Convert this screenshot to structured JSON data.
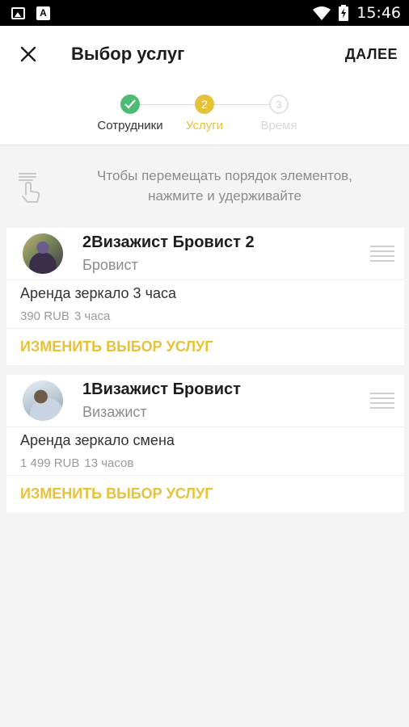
{
  "status_bar": {
    "time": "15:46",
    "icons": [
      "image-icon",
      "a-icon",
      "wifi-icon",
      "battery-charging-icon"
    ]
  },
  "app_bar": {
    "title": "Выбор услуг",
    "next_label": "ДАЛЕЕ",
    "close_icon": "close-icon"
  },
  "stepper": {
    "steps": [
      {
        "label": "Сотрудники",
        "state": "done",
        "marker": ""
      },
      {
        "label": "Услуги",
        "state": "active",
        "marker": "2"
      },
      {
        "label": "Время",
        "state": "pending",
        "marker": "3"
      }
    ]
  },
  "hint": {
    "text_line1": "Чтобы перемещать порядок элементов,",
    "text_line2": "нажмите и удерживайте",
    "icon": "touch-hold-icon"
  },
  "cards": [
    {
      "employee_name": "2Визажист Бровист 2",
      "employee_role": "Бровист",
      "service_name": "Аренда зеркало 3 часа",
      "price": "390 RUB",
      "duration": "3 часа",
      "change_label": "ИЗМЕНИТЬ ВЫБОР УСЛУГ"
    },
    {
      "employee_name": "1Визажист Бровист",
      "employee_role": "Визажист",
      "service_name": "Аренда зеркало смена",
      "price": "1 499 RUB",
      "duration": "13 часов",
      "change_label": "ИЗМЕНИТЬ ВЫБОР УСЛУГ"
    }
  ],
  "colors": {
    "accent": "#e7c13a",
    "done": "#4cbb74"
  }
}
